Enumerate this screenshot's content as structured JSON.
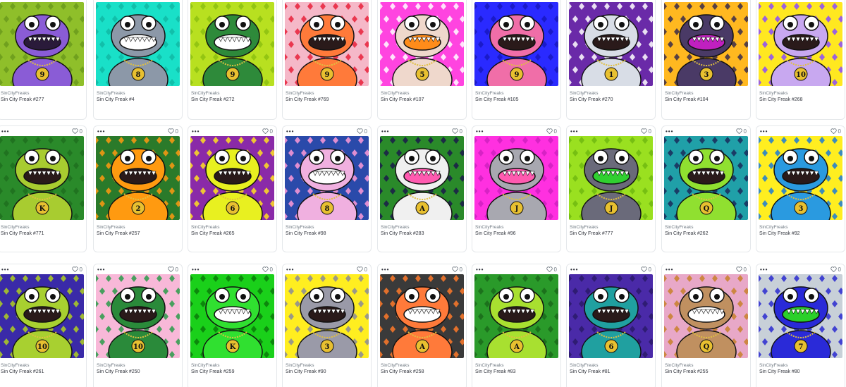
{
  "likes_label": "0",
  "more_label": "•••",
  "collection_name": "SinCityFreaks",
  "rows": [
    [
      {
        "name": "Sin City Freak #277",
        "bg": "#8fbf2a",
        "pattern": "#6b9a1c",
        "body": "#8a5cd6",
        "mouth": "#2a1a3a",
        "badge": "9"
      },
      {
        "name": "Sin City Freak #4",
        "bg": "#19e0c8",
        "pattern": "#10b8a4",
        "body": "#8c98a8",
        "mouth": "#ffffff",
        "badge": "8"
      },
      {
        "name": "Sin City Freak #272",
        "bg": "#b8e020",
        "pattern": "#8cc010",
        "body": "#2e8a3a",
        "mouth": "#ffffff",
        "badge": "9"
      },
      {
        "name": "Sin City Freak #769",
        "bg": "#f5b8c8",
        "pattern": "#e8203a",
        "body": "#ff7a3a",
        "mouth": "#2a1a1a",
        "badge": "9"
      },
      {
        "name": "Sin City Freak #107",
        "bg": "#ff44e0",
        "pattern": "#ffffff",
        "body": "#efd8cc",
        "mouth": "#ff8c1a",
        "badge": "5"
      },
      {
        "name": "Sin City Freak #105",
        "bg": "#2a2aff",
        "pattern": "#1818c0",
        "body": "#f06ea8",
        "mouth": "#2a1a1a",
        "badge": "9"
      },
      {
        "name": "Sin City Freak #270",
        "bg": "#6a2aa8",
        "pattern": "#ffffff",
        "body": "#d8dde6",
        "mouth": "#2a1a1a",
        "badge": "1"
      },
      {
        "name": "Sin City Freak #104",
        "bg": "#ffb820",
        "pattern": "#3a2a4a",
        "body": "#4a3a66",
        "mouth": "#c020c0",
        "badge": "3"
      },
      {
        "name": "Sin City Freak #268",
        "bg": "#ffe820",
        "pattern": "#8a4aff",
        "body": "#c8a8f0",
        "mouth": "#2a1a1a",
        "badge": "10"
      }
    ],
    [
      {
        "name": "Sin City Freak #771",
        "bg": "#2a8a2a",
        "pattern": "#1f6e1f",
        "body": "#a8cc30",
        "mouth": "#2a1a1a",
        "badge": "K"
      },
      {
        "name": "Sin City Freak #257",
        "bg": "#2a7a2a",
        "pattern": "#ff9a10",
        "body": "#ff9a10",
        "mouth": "#2a1a1a",
        "badge": "2"
      },
      {
        "name": "Sin City Freak #265",
        "bg": "#8a2aa8",
        "pattern": "#ffe020",
        "body": "#e8f020",
        "mouth": "#2a1a1a",
        "badge": "6"
      },
      {
        "name": "Sin City Freak #98",
        "bg": "#2a4aaa",
        "pattern": "#ff9ad8",
        "body": "#f0b0e0",
        "mouth": "#ffffff",
        "badge": "8"
      },
      {
        "name": "Sin City Freak #283",
        "bg": "#2a8a2a",
        "pattern": "#1a1a4a",
        "body": "#f0f0f0",
        "mouth": "#ff5ab0",
        "badge": "A"
      },
      {
        "name": "Sin City Freak #96",
        "bg": "#ff30e0",
        "pattern": "#d020c0",
        "body": "#a8a8b0",
        "mouth": "#ff5ab0",
        "badge": "J"
      },
      {
        "name": "Sin City Freak #777",
        "bg": "#9ae020",
        "pattern": "#70b810",
        "body": "#6a6a7a",
        "mouth": "#30d030",
        "badge": "J"
      },
      {
        "name": "Sin City Freak #262",
        "bg": "#20a0a8",
        "pattern": "#1a2a5a",
        "body": "#90e030",
        "mouth": "#2a1a1a",
        "badge": "Q"
      },
      {
        "name": "Sin City Freak #92",
        "bg": "#ffee20",
        "pattern": "#1a7ad8",
        "body": "#2a9ae0",
        "mouth": "#2a1a1a",
        "badge": "3"
      }
    ],
    [
      {
        "name": "Sin City Freak #261",
        "bg": "#3a2aa8",
        "pattern": "#b0d020",
        "body": "#a8d030",
        "mouth": "#2a1a1a",
        "badge": "10"
      },
      {
        "name": "Sin City Freak #250",
        "bg": "#f8b8d8",
        "pattern": "#2a9a4a",
        "body": "#2a8a3a",
        "mouth": "#2a1a1a",
        "badge": "10"
      },
      {
        "name": "Sin City Freak #259",
        "bg": "#1ad01a",
        "pattern": "#0a7a0a",
        "body": "#30e030",
        "mouth": "#ffffff",
        "badge": "K"
      },
      {
        "name": "Sin City Freak #90",
        "bg": "#ffee20",
        "pattern": "#8a8a9a",
        "body": "#9a9aa8",
        "mouth": "#2a1a1a",
        "badge": "3"
      },
      {
        "name": "Sin City Freak #258",
        "bg": "#3a3a3a",
        "pattern": "#ff7a2a",
        "body": "#ff7a3a",
        "mouth": "#ffffff",
        "badge": "A"
      },
      {
        "name": "Sin City Freak #83",
        "bg": "#2a9a2a",
        "pattern": "#1a6a1a",
        "body": "#a8e030",
        "mouth": "#2a1a1a",
        "badge": "A"
      },
      {
        "name": "Sin City Freak #81",
        "bg": "#4a2aa8",
        "pattern": "#2a1a6a",
        "body": "#20a0a0",
        "mouth": "#2a1a1a",
        "badge": "6"
      },
      {
        "name": "Sin City Freak #255",
        "bg": "#e8a8c8",
        "pattern": "#c8802a",
        "body": "#c09060",
        "mouth": "#ffffff",
        "badge": "Q"
      },
      {
        "name": "Sin City Freak #80",
        "bg": "#c8d0d8",
        "pattern": "#2a2ad0",
        "body": "#2a2ad8",
        "mouth": "#2ad02a",
        "badge": "7"
      }
    ]
  ]
}
